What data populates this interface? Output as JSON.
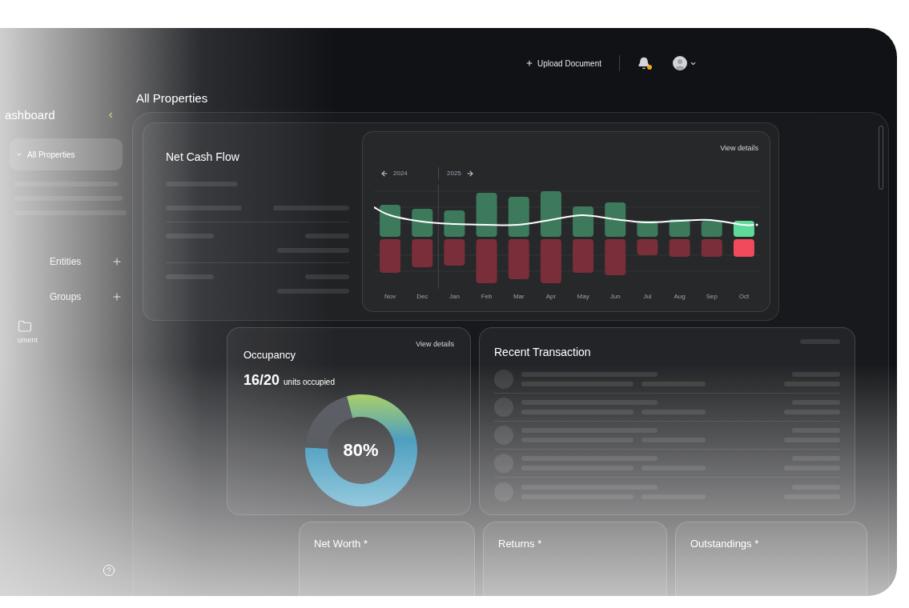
{
  "top_bar": {
    "upload_label": "Upload Document",
    "has_unread": true
  },
  "sidebar": {
    "title": "ashboard",
    "items": [
      {
        "label": "All Properties",
        "kind": "nav",
        "selected": true
      },
      {
        "label": "Entities",
        "kind": "section",
        "selected": false
      },
      {
        "label": "Groups",
        "kind": "section",
        "selected": false
      },
      {
        "label": "ument",
        "kind": "shortcut",
        "selected": false
      }
    ]
  },
  "page_title": "All Properties",
  "net_cash_flow": {
    "title": "Net Cash Flow",
    "view_details": "View details",
    "year_prev": "2024",
    "year_next": "2025",
    "months": [
      {
        "label": "Nov",
        "selected": false
      },
      {
        "label": "Dec",
        "selected": false
      },
      {
        "label": "Jan",
        "selected": false
      },
      {
        "label": "Feb",
        "selected": false
      },
      {
        "label": "Mar",
        "selected": false
      },
      {
        "label": "Apr",
        "selected": false
      },
      {
        "label": "May",
        "selected": false
      },
      {
        "label": "Jun",
        "selected": false
      },
      {
        "label": "Jul",
        "selected": false
      },
      {
        "label": "Aug",
        "selected": false
      },
      {
        "label": "Sep",
        "selected": false
      },
      {
        "label": "Oct",
        "selected": true
      }
    ]
  },
  "occupancy": {
    "title": "Occupancy",
    "view_details": "View details",
    "count": "16/20",
    "count_label": "units occupied",
    "percent": "80%",
    "chart_data": {
      "type": "donut",
      "values": [
        80,
        20
      ]
    }
  },
  "recent_transaction": {
    "title": "Recent Transaction"
  },
  "summary_cards": [
    {
      "title": "Net Worth *"
    },
    {
      "title": "Returns *"
    },
    {
      "title": "Outstandings *"
    }
  ]
}
